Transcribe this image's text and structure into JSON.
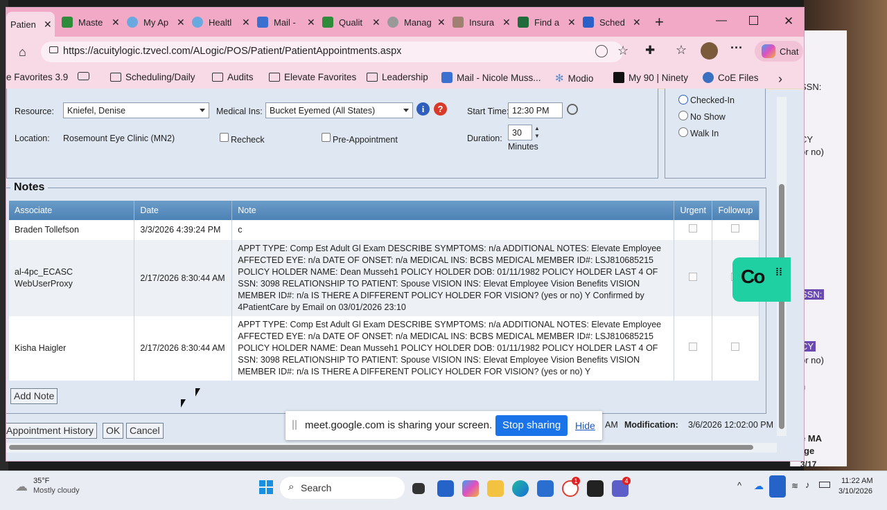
{
  "tabs": [
    {
      "label": "Patien",
      "color": "#f6d7e3",
      "active": true
    },
    {
      "label": "Maste",
      "color": "#2e8b3a"
    },
    {
      "label": "My Ap",
      "color": "#6aa9e0"
    },
    {
      "label": "Healtl",
      "color": "#6aa9e0"
    },
    {
      "label": "Mail -",
      "color": "#3b6fd0"
    },
    {
      "label": "Qualit",
      "color": "#2e8b3a"
    },
    {
      "label": "Manag",
      "color": "#999999"
    },
    {
      "label": "Insura",
      "color": "#a08070"
    },
    {
      "label": "Find a",
      "color": "#1f6b3a"
    },
    {
      "label": "Sched",
      "color": "#2a60c8"
    }
  ],
  "new_tab": "+",
  "url": "https://acuitylogic.tzvecl.com/ALogic/POS/Patient/PatientAppointments.aspx",
  "chat_label": "Chat",
  "favorites": [
    {
      "label": "e Favorites 3.9",
      "icon": "none"
    },
    {
      "label": "",
      "icon": "card"
    },
    {
      "label": "Scheduling/Daily",
      "icon": "folder"
    },
    {
      "label": "Audits",
      "icon": "folder"
    },
    {
      "label": "Elevate Favorites",
      "icon": "folder"
    },
    {
      "label": "Leadership",
      "icon": "folder"
    },
    {
      "label": "Mail - Nicole Muss...",
      "icon": "mail"
    },
    {
      "label": "Modio",
      "icon": "gear"
    },
    {
      "label": "My 90 | Ninety",
      "icon": "ninety"
    },
    {
      "label": "CoE Files",
      "icon": "coe"
    }
  ],
  "form": {
    "resource_label": "Resource:",
    "resource_value": "Kniefel, Denise",
    "medical_ins_label": "Medical Ins:",
    "medical_ins_value": "Bucket Eyemed (All States)",
    "start_time_label": "Start Time:",
    "start_time_value": "12:30 PM",
    "location_label": "Location:",
    "location_value": "Rosemount Eye Clinic (MN2)",
    "recheck_label": "Recheck",
    "pre_appointment_label": "Pre-Appointment",
    "duration_label": "Duration:",
    "duration_value": "30",
    "minutes_label": "Minutes",
    "status_options": [
      "Checked-In",
      "No Show",
      "Walk In"
    ]
  },
  "notes": {
    "title": "Notes",
    "columns": [
      "Associate",
      "Date",
      "Note",
      "Urgent",
      "Followup"
    ],
    "rows": [
      {
        "associate": "Braden Tollefson",
        "date": "3/3/2026 4:39:24 PM",
        "note": "c"
      },
      {
        "associate": "al-4pc_ECASC WebUserProxy",
        "date": "2/17/2026 8:30:44 AM",
        "note": "APPT TYPE: Comp Est Adult Gl Exam DESCRIBE SYMPTOMS: n/a ADDITIONAL NOTES: Elevate Employee AFFECTED EYE: n/a DATE OF ONSET: n/a MEDICAL INS: BCBS MEDICAL MEMBER ID#: LSJ810685215 POLICY HOLDER NAME: Dean Musseh1 POLICY HOLDER DOB: 01/11/1982 POLICY HOLDER LAST 4 OF SSN: 3098 RELATIONSHIP TO PATIENT: Spouse VISION INS: Elevat Employee Vision Benefits VISION MEMBER ID#: n/a IS THERE A DIFFERENT POLICY HOLDER FOR VISION? (yes or no) Y Confirmed by 4PatientCare by Email on 03/01/2026 23:10"
      },
      {
        "associate": "Kisha Haigler",
        "date": "2/17/2026 8:30:44 AM",
        "note": "APPT TYPE: Comp Est Adult Gl Exam DESCRIBE SYMPTOMS: n/a ADDITIONAL NOTES: Elevate Employee AFFECTED EYE: n/a DATE OF ONSET: n/a MEDICAL INS: BCBS MEDICAL MEMBER ID#: LSJ810685215 POLICY HOLDER NAME: Dean Musseh1 POLICY HOLDER DOB: 01/11/1982 POLICY HOLDER LAST 4 OF SSN: 3098 RELATIONSHIP TO PATIENT: Spouse VISION INS: Elevat Employee Vision Benefits VISION MEMBER ID#: n/a IS THERE A DIFFERENT POLICY HOLDER FOR VISION? (yes or no) Y"
      }
    ],
    "add_note_label": "Add Note"
  },
  "footer": {
    "appointment_history_label": "Appointment History",
    "ok_label": "OK",
    "cancel_label": "Cancel",
    "partial_text": "AM",
    "modification_label": "Modification:",
    "modification_value": "3/6/2026 12:02:00 PM"
  },
  "share_bar": {
    "message": "meet.google.com is sharing your screen.",
    "stop_label": "Stop sharing",
    "hide_label": "Hide"
  },
  "right_pane": {
    "lines": [
      "SSN:",
      "CY",
      "or no)",
      "SSN:",
      "CY",
      "or no)",
      "n",
      "e MA",
      "rge",
      "3/17"
    ]
  },
  "widget_label": "Co",
  "taskbar": {
    "weather_temp": "35°F",
    "weather_desc": "Mostly cloudy",
    "search_label": "Search",
    "time": "11:22 AM",
    "date": "3/10/2026",
    "badge_1": "1",
    "badge_4": "4"
  }
}
